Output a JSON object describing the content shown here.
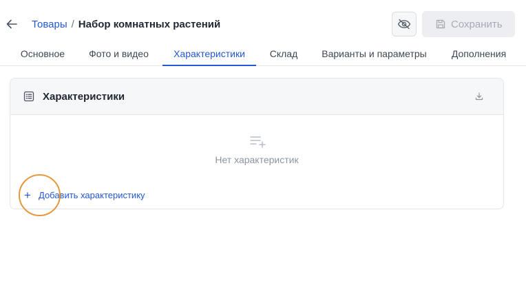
{
  "header": {
    "breadcrumb": {
      "parent": "Товары",
      "separator": "/",
      "current": "Набор комнатных растений"
    },
    "save_label": "Сохранить"
  },
  "tabs": [
    {
      "label": "Основное",
      "active": false
    },
    {
      "label": "Фото и видео",
      "active": false
    },
    {
      "label": "Характеристики",
      "active": true
    },
    {
      "label": "Склад",
      "active": false
    },
    {
      "label": "Варианты и параметры",
      "active": false
    },
    {
      "label": "Дополнения",
      "active": false
    }
  ],
  "card": {
    "title": "Характеристики",
    "empty_text": "Нет характеристик",
    "add_label": "Добавить характеристику",
    "add_glyph": "+"
  },
  "icons": {
    "back": "arrow-left-icon",
    "hide": "eye-off-icon",
    "save": "floppy-disk-icon",
    "card": "list-icon",
    "download": "download-icon",
    "empty": "list-add-icon"
  },
  "colors": {
    "accent": "#2357d4",
    "muted_text": "#8d95a2",
    "highlight_ring": "#e8963a"
  }
}
